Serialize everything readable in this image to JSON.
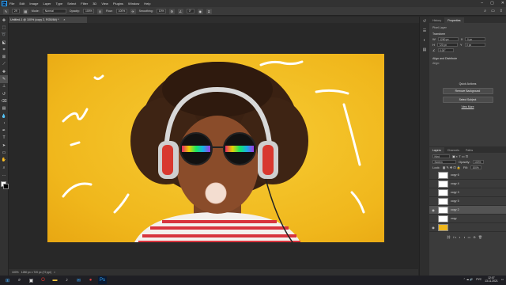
{
  "menu": {
    "app_logo": "Ps",
    "items": [
      "File",
      "Edit",
      "Image",
      "Layer",
      "Type",
      "Select",
      "Filter",
      "3D",
      "View",
      "Plugins",
      "Window",
      "Help"
    ]
  },
  "options_bar": {
    "mode_label": "Mode:",
    "mode_value": "Normal",
    "opacity_label": "Opacity:",
    "opacity_value": "100%",
    "flow_label": "Flow:",
    "flow_value": "100%",
    "smoothing_label": "Smoothing:",
    "smoothing_value": "10%",
    "angle_value": "0°",
    "brush_size": "29"
  },
  "document": {
    "tab_title": "Untitled-1 @ 100% (copy 2, RGB/8#) *",
    "close_glyph": "×"
  },
  "status": {
    "zoom": "100%",
    "size": "1280 px x 720 px (72 ppi)",
    "arrow": ">"
  },
  "properties_panel": {
    "tabs": [
      "History",
      "Properties"
    ],
    "active_tab": "Properties",
    "kind": "Pixel Layer",
    "transform_heading": "Transform",
    "w_label": "W",
    "w_value": "1280 px",
    "x_label": "X",
    "x_value": "0 px",
    "h_label": "H",
    "h_value": "720 px",
    "y_label": "Y",
    "y_value": "0 px",
    "angle_value": "0.00°",
    "align_heading": "Align and Distribute",
    "align_sub": "Align:",
    "quick_actions_heading": "Quick Actions",
    "remove_bg": "Remove Background",
    "select_subject": "Select Subject",
    "view_more": "View More"
  },
  "layers_panel": {
    "tabs": [
      "Layers",
      "Channels",
      "Paths"
    ],
    "active_tab": "Layers",
    "kind_value": "Kind",
    "blend_value": "Screen",
    "opacity_label": "Opacity:",
    "opacity_value": "100%",
    "lock_label": "Lock:",
    "fill_label": "Fill:",
    "fill_value": "100%",
    "layers": [
      {
        "name": "copy 6",
        "visible": false,
        "selected": false
      },
      {
        "name": "copy 4",
        "visible": false,
        "selected": false
      },
      {
        "name": "copy 3",
        "visible": false,
        "selected": false
      },
      {
        "name": "copy 5",
        "visible": false,
        "selected": false
      },
      {
        "name": "copy 2",
        "visible": true,
        "selected": true
      },
      {
        "name": "copy",
        "visible": false,
        "selected": false
      },
      {
        "name": "",
        "visible": true,
        "selected": false
      }
    ],
    "footer_icons": "⛓ fx ◐ ◑ ▭ ⊕ 🗑"
  },
  "taskbar": {
    "lang": "РУС",
    "time": "12:07",
    "date": "13.11.2021"
  },
  "colors": {
    "photo_bg": "#f0b71c",
    "ps_blue": "#31a8ff",
    "ui_dark": "#282828"
  }
}
